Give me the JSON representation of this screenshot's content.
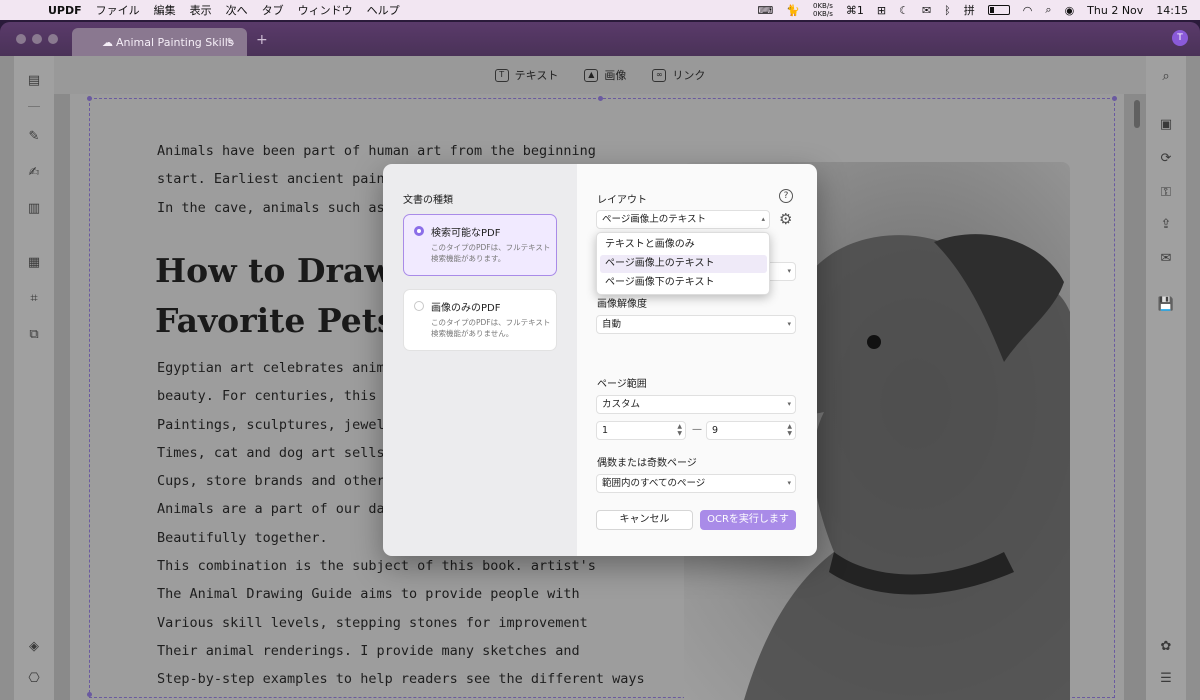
{
  "menubar": {
    "app_name": "UPDF",
    "items": [
      "ファイル",
      "編集",
      "表示",
      "次へ",
      "タブ",
      "ウィンドウ",
      "ヘルプ"
    ],
    "net_up": "0KB/s",
    "net_down": "0KB/s",
    "bracket_count": "1",
    "date": "Thu 2 Nov",
    "time": "14:15"
  },
  "window": {
    "tab_title": "Animal Painting Skills",
    "new_tab": "+",
    "avatar_letter": "T"
  },
  "toolbar": {
    "text_label": "テキスト",
    "image_label": "画像",
    "link_label": "リンク"
  },
  "document": {
    "para1": [
      "Animals have been part of human art from the beginning",
      "start. Earliest ancient painting, fou",
      "In the cave, animals such as bison"
    ],
    "heading": [
      "How to Draw C",
      "Favorite Pets"
    ],
    "para2": [
      "Egyptian art celebrates animals li",
      "beauty. For centuries, this horse h",
      "Paintings, sculptures, jewelry, and",
      "Times, cat and dog art sells a lot o",
      "Cups, store brands and other item",
      "Animals are a part of our daily life",
      "Beautifully together.",
      "This combination is the subject of this book. artist's",
      "The Animal Drawing Guide aims to provide people with",
      "Various skill levels, stepping stones for improvement",
      "Their animal renderings. I provide many sketches and",
      "Step-by-step examples to help readers see the different ways"
    ]
  },
  "ocr_dialog": {
    "doc_type_heading": "文書の種類",
    "options": [
      {
        "title": "検索可能なPDF",
        "desc": "このタイプのPDFは、フルテキスト検索機能があります。",
        "selected": true
      },
      {
        "title": "画像のみのPDF",
        "desc": "このタイプのPDFは、フルテキスト検索機能がありません。",
        "selected": false
      }
    ],
    "layout_heading": "レイアウト",
    "layout_value": "ページ画像上のテキスト",
    "layout_options": [
      "テキストと画像のみ",
      "ページ画像上のテキスト",
      "ページ画像下のテキスト"
    ],
    "resolution_heading": "画像解像度",
    "resolution_value": "自動",
    "page_range_heading": "ページ範囲",
    "page_range_value": "カスタム",
    "range_from": "1",
    "range_to": "9",
    "range_separator": "—",
    "odd_even_heading": "偶数または奇数ページ",
    "odd_even_value": "範囲内のすべてのページ",
    "cancel_label": "キャンセル",
    "run_label": "OCRを実行します"
  },
  "colors": {
    "accent": "#a98be8",
    "selected_card_bg": "#f1eaff"
  }
}
